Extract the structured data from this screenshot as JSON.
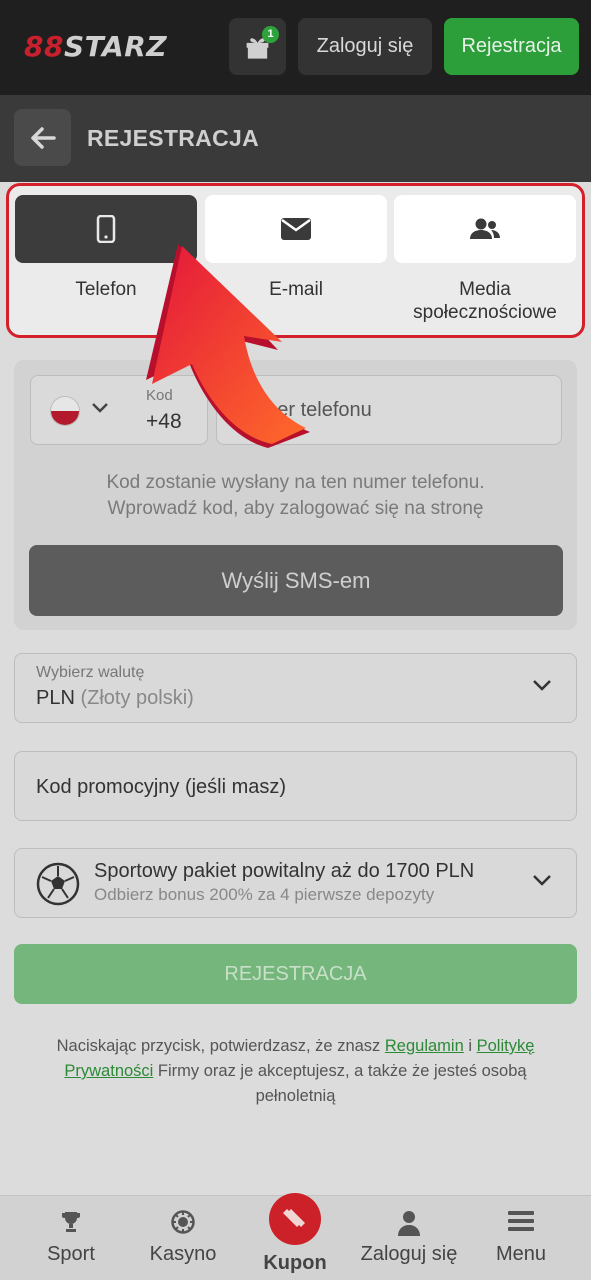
{
  "header": {
    "logo_prefix": "88",
    "logo_text": "STARZ",
    "gift_badge": "1",
    "login_label": "Zaloguj się",
    "register_label": "Rejestracja"
  },
  "page": {
    "title": "REJESTRACJA"
  },
  "tabs": [
    {
      "label": "Telefon",
      "icon": "phone-icon",
      "active": true
    },
    {
      "label": "E-mail",
      "icon": "envelope-icon",
      "active": false
    },
    {
      "label": "Media społecznościowe",
      "icon": "users-icon",
      "active": false
    }
  ],
  "phone_form": {
    "code_caption": "Kod",
    "code_value": "+48",
    "phone_placeholder": "Numer telefonu",
    "hint_line1": "Kod zostanie wysłany na ten numer telefonu.",
    "hint_line2": "Wprowadź kod, aby zalogować się na stronę",
    "send_sms_label": "Wyślij SMS-em"
  },
  "currency": {
    "caption": "Wybierz walutę",
    "code": "PLN",
    "name": "(Złoty polski)"
  },
  "promo": {
    "placeholder": "Kod promocyjny (jeśli masz)"
  },
  "bonus": {
    "title": "Sportowy pakiet powitalny aż do 1700 PLN",
    "subtitle": "Odbierz bonus 200% za 4 pierwsze depozyty"
  },
  "submit_label": "REJESTRACJA",
  "terms": {
    "part1": "Naciskając przycisk, potwierdzasz, że znasz ",
    "link1": "Regulamin",
    "part2": " i ",
    "link2a": "Politykę",
    "link2b": "Prywatności",
    "part3": " Firmy oraz je akceptujesz, a także że jesteś osobą pełnoletnią"
  },
  "bottom_nav": [
    {
      "label": "Sport",
      "icon": "trophy-icon"
    },
    {
      "label": "Kasyno",
      "icon": "casino-chip-icon"
    },
    {
      "label": "Kupon",
      "icon": "ticket-icon"
    },
    {
      "label": "Zaloguj się",
      "icon": "user-icon"
    },
    {
      "label": "Menu",
      "icon": "hamburger-icon"
    }
  ],
  "colors": {
    "brand_red": "#c8202c",
    "accent_green": "#2c9e3a",
    "highlight_border": "#d4202a"
  }
}
